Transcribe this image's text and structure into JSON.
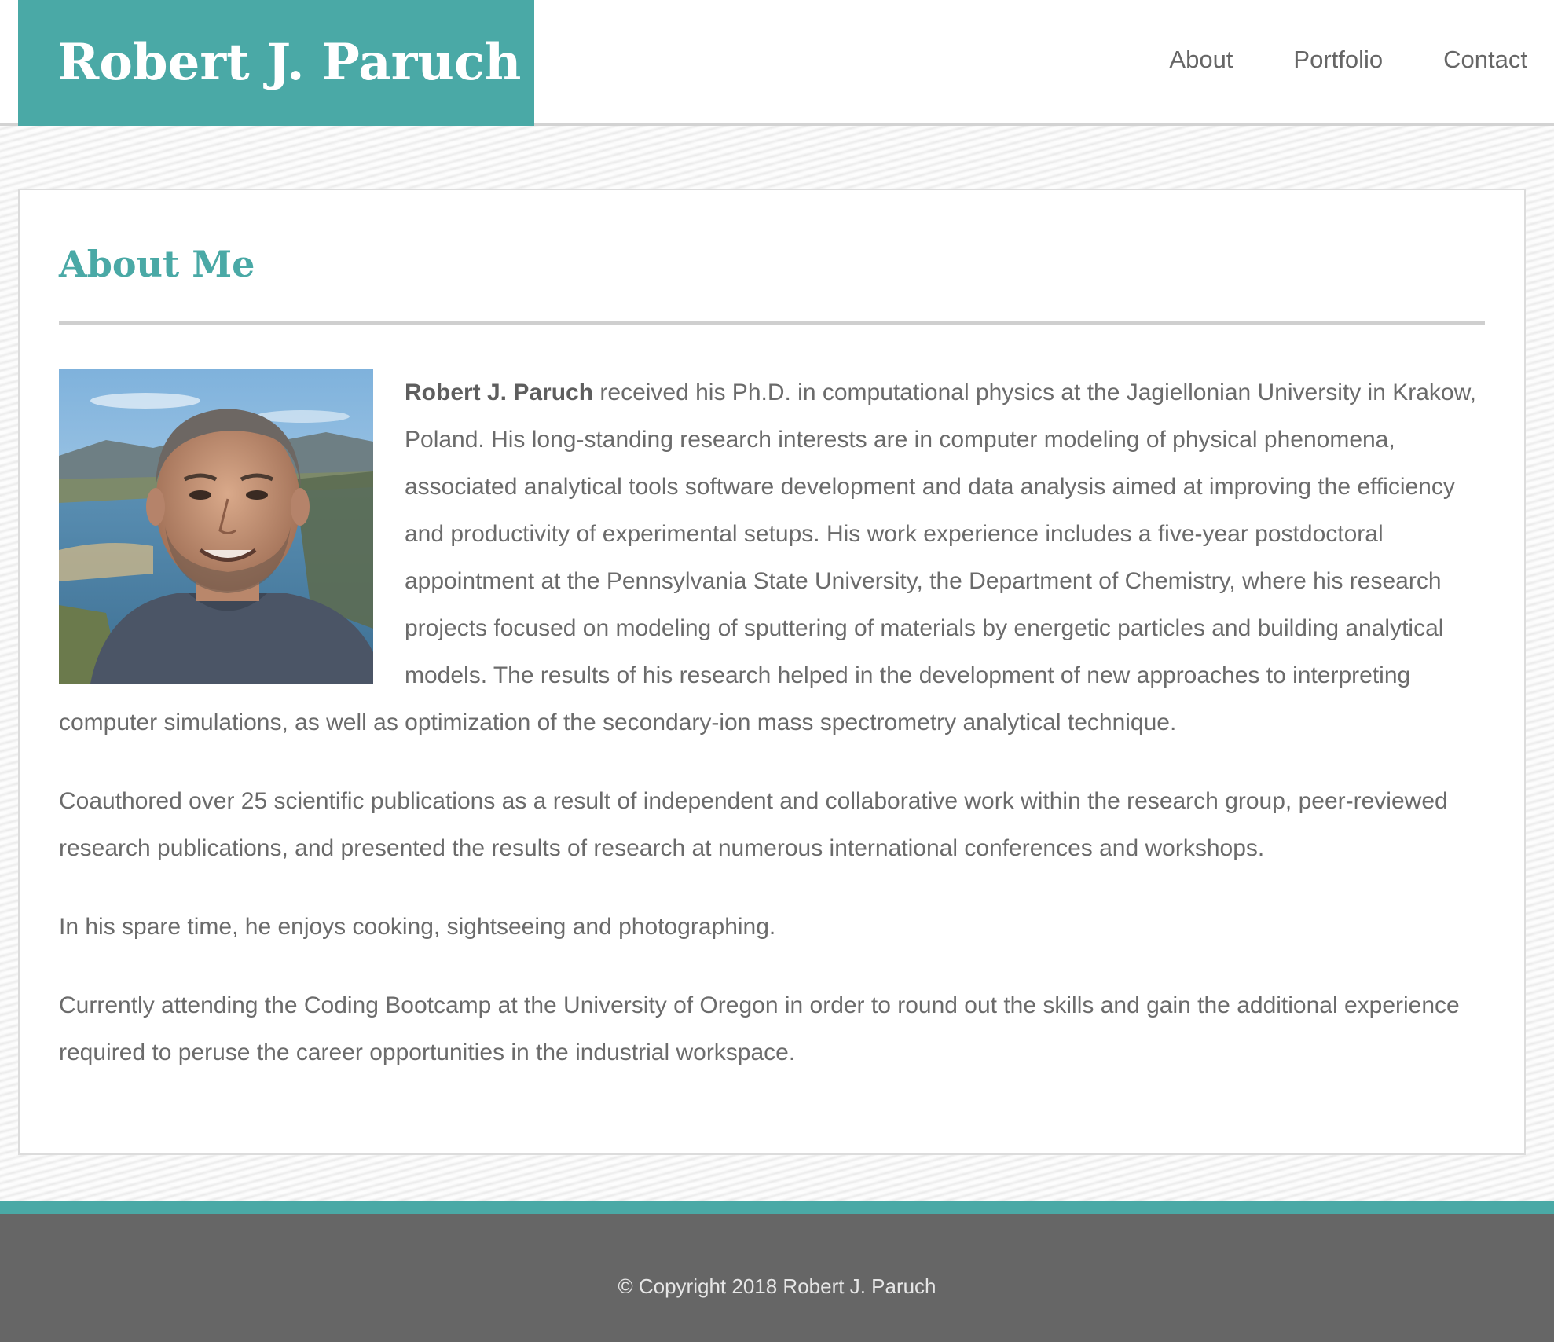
{
  "header": {
    "brand": "Robert J. Paruch",
    "nav": [
      {
        "label": "About"
      },
      {
        "label": "Portfolio"
      },
      {
        "label": "Contact"
      }
    ]
  },
  "main": {
    "title": "About Me",
    "portrait_alt": "Photo of Robert J. Paruch",
    "intro_name": "Robert J. Paruch",
    "intro_text": " received his Ph.D. in computational physics at the Jagiellonian University in Krakow, Poland. His long-standing research interests are in computer modeling of physical phenomena, associated analytical tools software development and data analysis aimed at improving the efficiency and productivity of experimental setups. His work experience includes a five-year postdoctoral appointment at the Pennsylvania State University, the Department of Chemistry, where his research projects focused on modeling of sputtering of materials by energetic particles and building analytical models. The results of his research helped in the development of new approaches to interpreting computer simulations, as well as optimization of the secondary-ion mass spectrometry analytical technique.",
    "paragraphs": [
      "Coauthored over 25 scientific publications as a result of independent and collaborative work within the research group, peer-reviewed research publications, and presented the results of research at numerous international conferences and workshops.",
      "In his spare time, he enjoys cooking, sightseeing and photographing.",
      "Currently attending the Coding Bootcamp at the University of Oregon in order to round out the skills and gain the additional experience required to peruse the career opportunities in the industrial workspace."
    ]
  },
  "footer": {
    "copyright": "© Copyright 2018 Robert J. Paruch"
  },
  "colors": {
    "accent": "#4aa9a6",
    "text": "#6b6b6b",
    "footer_bg": "#666666"
  }
}
